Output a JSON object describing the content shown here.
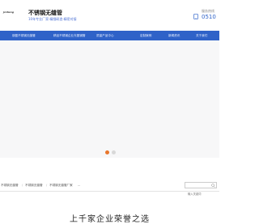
{
  "header": {
    "logo_text": "jinfeng",
    "title": "不锈钢无缝管",
    "subtitle": "10年专业厂家·精细研造·精密对接",
    "hotline_label": "服务热线",
    "hotline_number": "0510"
  },
  "nav": {
    "items": [
      {
        "label": "钢盈不锈钢无缝管"
      },
      {
        "label": "精品不锈钢企业光圈钢管"
      },
      {
        "label": "质量产品中心"
      },
      {
        "label": "定制案例"
      },
      {
        "label": "新闻资讯"
      },
      {
        "label": "关于我们"
      }
    ]
  },
  "banner": {
    "active_dot_color": "#e8762c",
    "inactive_dot_color": "#d8d8d8"
  },
  "breadcrumb": {
    "items": [
      "不锈钢无缝管",
      "不锈钢无缝管",
      "不锈钢无缝管厂家",
      "..."
    ],
    "separator": "/"
  },
  "search": {
    "placeholder": "输入关键词"
  },
  "section": {
    "title": "上千家企业荣誉之选"
  },
  "colors": {
    "brand_blue": "#2f62c8",
    "accent_orange": "#e8762c"
  }
}
